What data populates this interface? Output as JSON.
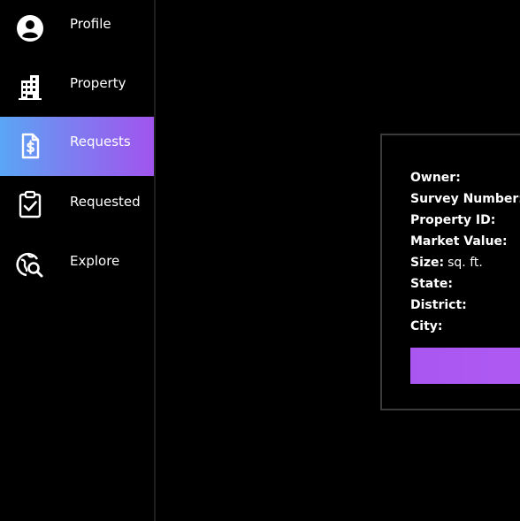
{
  "sidebar": {
    "items": [
      {
        "label": "Profile",
        "icon": "user-circle-icon",
        "active": false
      },
      {
        "label": "Property",
        "icon": "building-icon",
        "active": false
      },
      {
        "label": "Requests",
        "icon": "dollar-document-icon",
        "active": true
      },
      {
        "label": "Requested",
        "icon": "clipboard-check-icon",
        "active": false
      },
      {
        "label": "Explore",
        "icon": "globe-search-icon",
        "active": false
      }
    ]
  },
  "card": {
    "fields": {
      "owner": {
        "label": "Owner:",
        "value": ""
      },
      "survey_number": {
        "label": "Survey Number:",
        "value": ""
      },
      "property_id": {
        "label": "Property ID:",
        "value": ""
      },
      "market_value": {
        "label": "Market Value:",
        "value": ""
      },
      "size": {
        "label": "Size:",
        "value": "sq. ft."
      },
      "state": {
        "label": "State:",
        "value": ""
      },
      "district": {
        "label": "District:",
        "value": ""
      },
      "city": {
        "label": "City:",
        "value": ""
      }
    },
    "action_button": {
      "label": ""
    }
  },
  "colors": {
    "background": "#000000",
    "active_gradient_start": "#5aa6f5",
    "active_gradient_end": "#a154ee",
    "button": "#a955f0",
    "card_border": "#3a3a3a"
  }
}
